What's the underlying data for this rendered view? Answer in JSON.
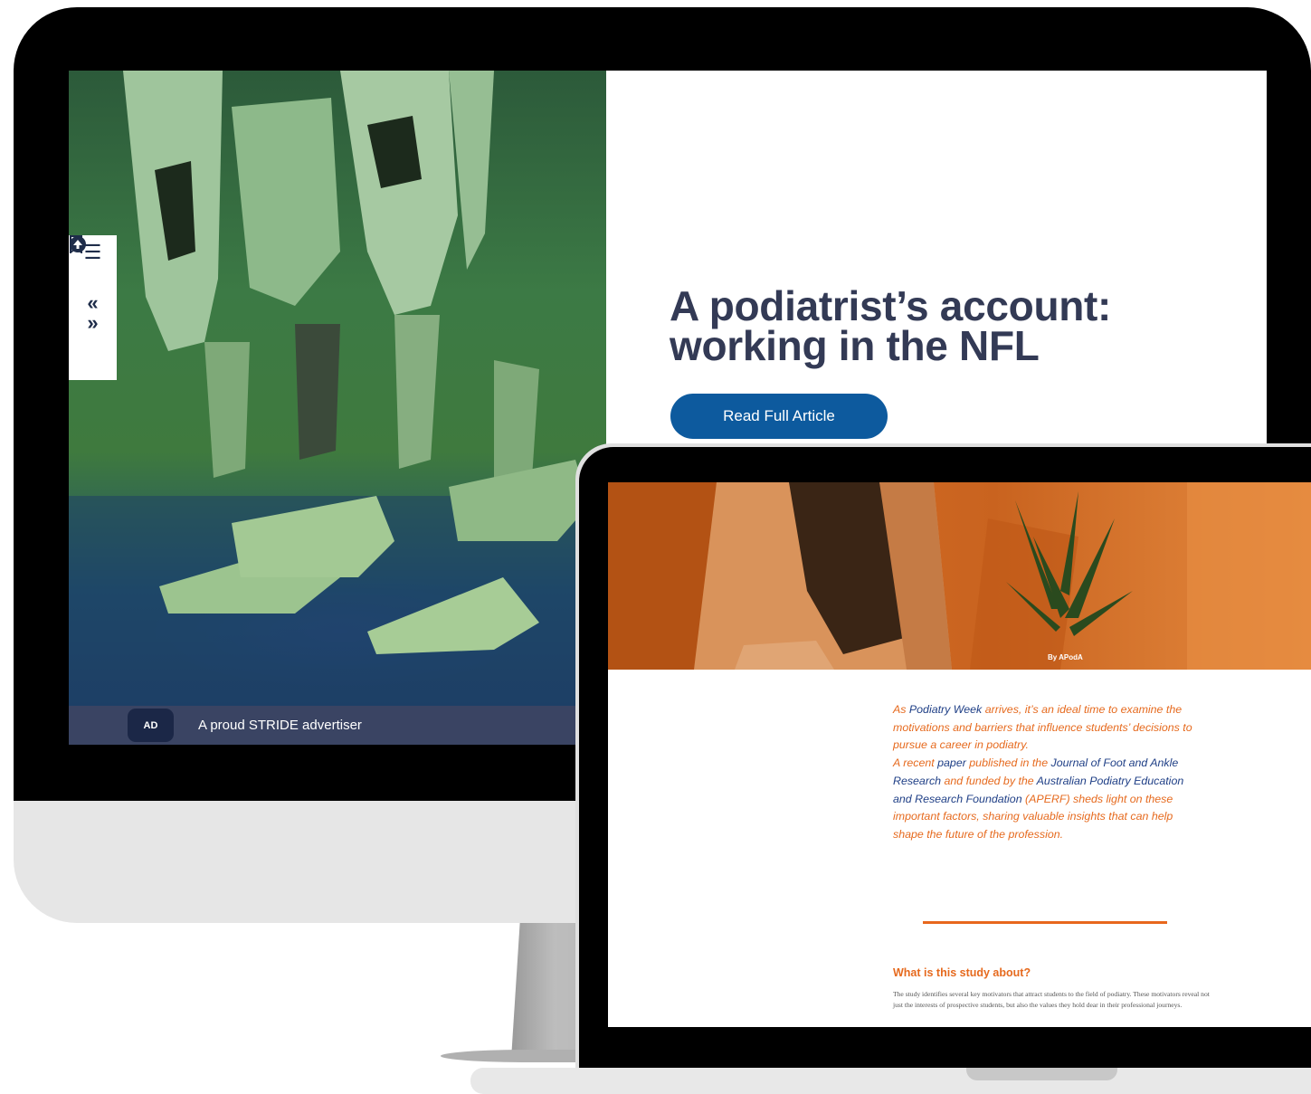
{
  "desktop": {
    "sidebar_tools": [
      {
        "name": "list-icon",
        "glyph": "☰"
      },
      {
        "name": "bookmark-icon",
        "glyph": "⌑"
      },
      {
        "name": "previous-icon",
        "glyph": "«"
      },
      {
        "name": "next-icon",
        "glyph": "»"
      },
      {
        "name": "scroll-up-icon",
        "glyph": "⬆"
      }
    ],
    "article_title_line1": "A podiatrist’s account:",
    "article_title_line2": "working in the NFL",
    "read_button_label": "Read Full Article",
    "ad_badge": "AD",
    "ad_text": "A proud STRIDE advertiser"
  },
  "laptop": {
    "byline": "By APodA",
    "intro": {
      "p1_a": "As ",
      "p1_link": "Podiatry Week",
      "p1_b": " arrives, it’s an ideal time to examine the motivations and barriers that influence students’ decisions to pursue a career in podiatry.",
      "p2_a": "A recent ",
      "p2_link1": "paper",
      "p2_b": " published in the ",
      "p2_link2": "Journal of Foot and Ankle Research",
      "p2_c": " and funded by the ",
      "p2_link3": "Australian Podiatry Education and Research Foundation",
      "p2_d": " (APERF) sheds light on these important factors, sharing valuable insights that can help shape the future of the profession."
    },
    "study_heading": "What is this study about?",
    "study_body": "The study identifies several key motivators that attract students to the field of podiatry. These motivators reveal not just the interests of prospective students, but also the values they hold dear in their professional journeys."
  },
  "colors": {
    "title_navy": "#333a55",
    "button_blue": "#0d5a9e",
    "ad_bar": "#3a4463",
    "accent_orange": "#e66a1e",
    "link_navy": "#1f3f86"
  }
}
